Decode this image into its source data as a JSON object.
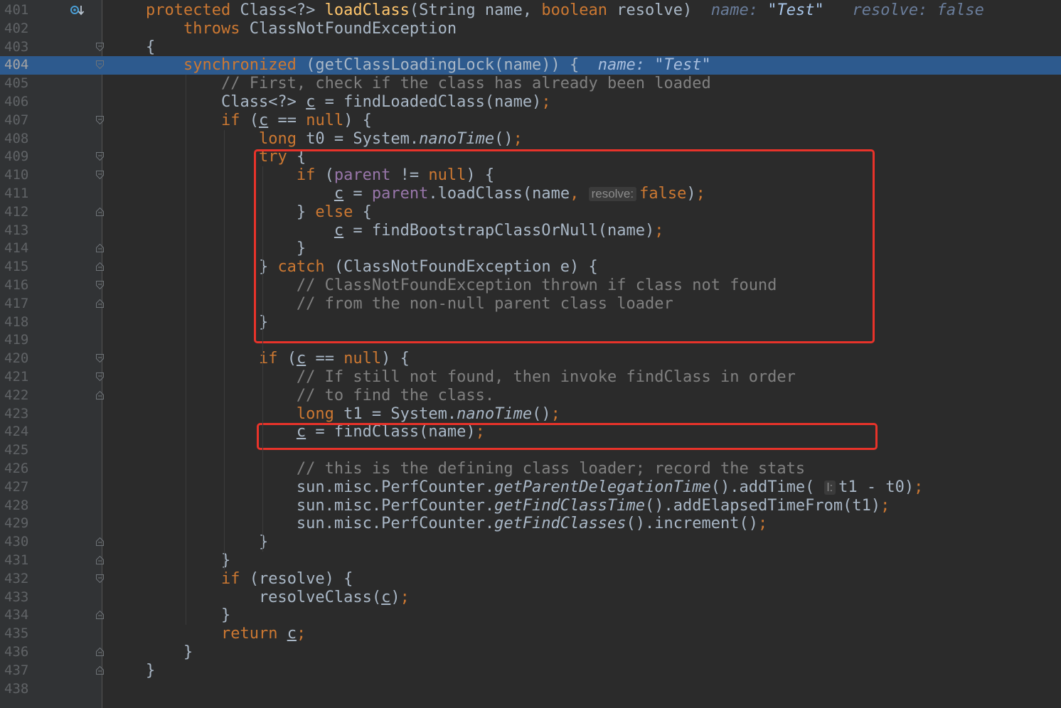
{
  "editor": {
    "colors": {
      "background": "#2b2b2b",
      "gutter": "#313335",
      "current_line": "#2d5a8e",
      "keyword": "#cc7832",
      "method_decl": "#ffc66d",
      "field": "#9876aa",
      "comment": "#808080",
      "annotation_box": "#e8332a"
    },
    "debug_marker_icon": "step-into-debug-icon",
    "lines": [
      {
        "no": "401",
        "segments": [
          {
            "t": "protected ",
            "c": "kw"
          },
          {
            "t": "Class<?> "
          },
          {
            "t": "loadClass",
            "c": "fn"
          },
          {
            "t": "(String name, "
          },
          {
            "t": "boolean ",
            "c": "kw"
          },
          {
            "t": "resolve)  "
          },
          {
            "t": "name: ",
            "c": "inlay-debug"
          },
          {
            "t": "\"Test\"",
            "c": "inlay-debug-str"
          },
          {
            "t": "   resolve: false",
            "c": "inlay-debug"
          }
        ]
      },
      {
        "no": "402",
        "segments": [
          {
            "t": "    "
          },
          {
            "t": "throws ",
            "c": "kw"
          },
          {
            "t": "ClassNotFoundException"
          }
        ]
      },
      {
        "no": "403",
        "segments": [
          {
            "t": "{"
          }
        ]
      },
      {
        "no": "404",
        "segments": [
          {
            "t": "    "
          },
          {
            "t": "synchronized ",
            "c": "kw"
          },
          {
            "t": "(getClassLoadingLock(name)) {  "
          },
          {
            "t": "name: ",
            "c": "inlay-debug"
          },
          {
            "t": "\"Test\"",
            "c": "inlay-debug"
          }
        ]
      },
      {
        "no": "405",
        "segments": [
          {
            "t": "        "
          },
          {
            "t": "// First, check if the class has already been loaded",
            "c": "cm"
          }
        ]
      },
      {
        "no": "406",
        "segments": [
          {
            "t": "        Class<?> "
          },
          {
            "t": "c",
            "c": "var-u"
          },
          {
            "t": " = findLoadedClass(name)"
          },
          {
            "t": ";",
            "c": "semi"
          }
        ]
      },
      {
        "no": "407",
        "segments": [
          {
            "t": "        "
          },
          {
            "t": "if ",
            "c": "kw"
          },
          {
            "t": "("
          },
          {
            "t": "c",
            "c": "var-u"
          },
          {
            "t": " == "
          },
          {
            "t": "null",
            "c": "kw"
          },
          {
            "t": ") {"
          }
        ]
      },
      {
        "no": "408",
        "segments": [
          {
            "t": "            "
          },
          {
            "t": "long ",
            "c": "kw"
          },
          {
            "t": "t0 = System."
          },
          {
            "t": "nanoTime",
            "c": "st"
          },
          {
            "t": "()"
          },
          {
            "t": ";",
            "c": "semi"
          }
        ]
      },
      {
        "no": "409",
        "segments": [
          {
            "t": "            "
          },
          {
            "t": "try ",
            "c": "kw"
          },
          {
            "t": "{"
          }
        ]
      },
      {
        "no": "410",
        "segments": [
          {
            "t": "                "
          },
          {
            "t": "if ",
            "c": "kw"
          },
          {
            "t": "("
          },
          {
            "t": "parent",
            "c": "field"
          },
          {
            "t": " != "
          },
          {
            "t": "null",
            "c": "kw"
          },
          {
            "t": ") {"
          }
        ]
      },
      {
        "no": "411",
        "segments": [
          {
            "t": "                    "
          },
          {
            "t": "c",
            "c": "var-u"
          },
          {
            "t": " = "
          },
          {
            "t": "parent",
            "c": "field"
          },
          {
            "t": ".loadClass(name"
          },
          {
            "t": ", ",
            "c": "semi"
          },
          {
            "hint": "resolve:"
          },
          {
            "t": "false",
            "c": "kw"
          },
          {
            "t": ")"
          },
          {
            "t": ";",
            "c": "semi"
          }
        ]
      },
      {
        "no": "412",
        "segments": [
          {
            "t": "                } "
          },
          {
            "t": "else ",
            "c": "kw"
          },
          {
            "t": "{"
          }
        ]
      },
      {
        "no": "413",
        "segments": [
          {
            "t": "                    "
          },
          {
            "t": "c",
            "c": "var-u"
          },
          {
            "t": " = findBootstrapClassOrNull(name)"
          },
          {
            "t": ";",
            "c": "semi"
          }
        ]
      },
      {
        "no": "414",
        "segments": [
          {
            "t": "                }"
          }
        ]
      },
      {
        "no": "415",
        "segments": [
          {
            "t": "            } "
          },
          {
            "t": "catch ",
            "c": "kw"
          },
          {
            "t": "(ClassNotFoundException e) {"
          }
        ]
      },
      {
        "no": "416",
        "segments": [
          {
            "t": "                "
          },
          {
            "t": "// ClassNotFoundException thrown if class not found",
            "c": "cm"
          }
        ]
      },
      {
        "no": "417",
        "segments": [
          {
            "t": "                "
          },
          {
            "t": "// from the non-null parent class loader",
            "c": "cm"
          }
        ]
      },
      {
        "no": "418",
        "segments": [
          {
            "t": "            }"
          }
        ]
      },
      {
        "no": "419",
        "segments": []
      },
      {
        "no": "420",
        "segments": [
          {
            "t": "            "
          },
          {
            "t": "if ",
            "c": "kw"
          },
          {
            "t": "("
          },
          {
            "t": "c",
            "c": "var-u"
          },
          {
            "t": " == "
          },
          {
            "t": "null",
            "c": "kw"
          },
          {
            "t": ") {"
          }
        ]
      },
      {
        "no": "421",
        "segments": [
          {
            "t": "                "
          },
          {
            "t": "// If still not found, then invoke findClass in order",
            "c": "cm"
          }
        ]
      },
      {
        "no": "422",
        "segments": [
          {
            "t": "                "
          },
          {
            "t": "// to find the class.",
            "c": "cm"
          }
        ]
      },
      {
        "no": "423",
        "segments": [
          {
            "t": "                "
          },
          {
            "t": "long ",
            "c": "kw"
          },
          {
            "t": "t1 = System."
          },
          {
            "t": "nanoTime",
            "c": "st"
          },
          {
            "t": "()"
          },
          {
            "t": ";",
            "c": "semi"
          }
        ]
      },
      {
        "no": "424",
        "segments": [
          {
            "t": "                "
          },
          {
            "t": "c",
            "c": "var-u"
          },
          {
            "t": " = findClass(name)"
          },
          {
            "t": ";",
            "c": "semi"
          }
        ]
      },
      {
        "no": "425",
        "segments": []
      },
      {
        "no": "426",
        "segments": [
          {
            "t": "                "
          },
          {
            "t": "// this is the defining class loader; record the stats",
            "c": "cm"
          }
        ]
      },
      {
        "no": "427",
        "segments": [
          {
            "t": "                sun.misc.PerfCounter."
          },
          {
            "t": "getParentDelegationTime",
            "c": "st"
          },
          {
            "t": "().addTime( "
          },
          {
            "hint": "l:"
          },
          {
            "t": "t1 - t0)"
          },
          {
            "t": ";",
            "c": "semi"
          }
        ]
      },
      {
        "no": "428",
        "segments": [
          {
            "t": "                sun.misc.PerfCounter."
          },
          {
            "t": "getFindClassTime",
            "c": "st"
          },
          {
            "t": "().addElapsedTimeFrom(t1)"
          },
          {
            "t": ";",
            "c": "semi"
          }
        ]
      },
      {
        "no": "429",
        "segments": [
          {
            "t": "                sun.misc.PerfCounter."
          },
          {
            "t": "getFindClasses",
            "c": "st"
          },
          {
            "t": "().increment()"
          },
          {
            "t": ";",
            "c": "semi"
          }
        ]
      },
      {
        "no": "430",
        "segments": [
          {
            "t": "            }"
          }
        ]
      },
      {
        "no": "431",
        "segments": [
          {
            "t": "        }"
          }
        ]
      },
      {
        "no": "432",
        "segments": [
          {
            "t": "        "
          },
          {
            "t": "if ",
            "c": "kw"
          },
          {
            "t": "(resolve) {"
          }
        ]
      },
      {
        "no": "433",
        "segments": [
          {
            "t": "            resolveClass("
          },
          {
            "t": "c",
            "c": "var-u"
          },
          {
            "t": ")"
          },
          {
            "t": ";",
            "c": "semi"
          }
        ]
      },
      {
        "no": "434",
        "segments": [
          {
            "t": "        }"
          }
        ]
      },
      {
        "no": "435",
        "segments": [
          {
            "t": "        "
          },
          {
            "t": "return ",
            "c": "kw"
          },
          {
            "t": "c",
            "c": "var-u"
          },
          {
            "t": ";",
            "c": "semi"
          }
        ]
      },
      {
        "no": "436",
        "segments": [
          {
            "t": "    }"
          }
        ]
      },
      {
        "no": "437",
        "segments": [
          {
            "t": "}"
          }
        ]
      },
      {
        "no": "438",
        "segments": []
      }
    ],
    "current_line": "404",
    "fold_markers": {
      "403": "fold-start",
      "404": "fold-start",
      "407": "fold-start",
      "409": "fold-start",
      "410": "fold-start",
      "412": "fold-end",
      "414": "fold-end",
      "415": "fold-end",
      "416": "fold-start",
      "417": "fold-end",
      "420": "fold-start",
      "421": "fold-start",
      "422": "fold-end",
      "430": "fold-end",
      "431": "fold-end",
      "432": "fold-start",
      "434": "fold-end",
      "436": "fold-end",
      "437": "fold-end"
    }
  }
}
